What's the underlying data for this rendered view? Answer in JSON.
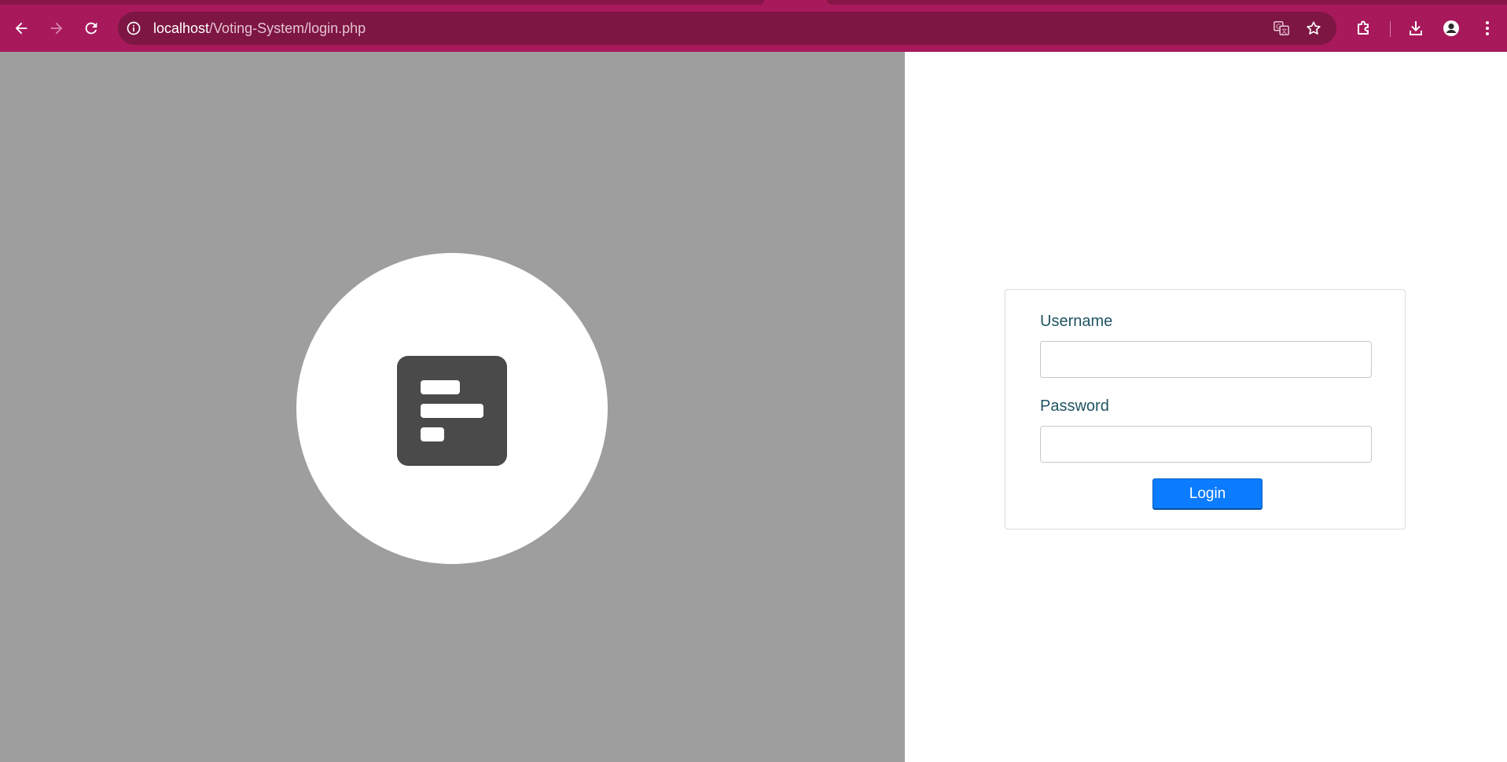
{
  "browser": {
    "url_host": "localhost",
    "url_path": "/Voting-System/login.php",
    "theme_color": "#a8195b",
    "omnibox_color": "#7d1642",
    "icons": {
      "back": "arrow-left-icon",
      "forward": "arrow-right-icon",
      "reload": "reload-icon",
      "site_info": "info-icon",
      "translate": "translate-icon",
      "bookmark": "star-icon",
      "extensions": "puzzle-icon",
      "downloads": "download-icon",
      "profile": "profile-icon",
      "menu": "kebab-menu-icon"
    }
  },
  "left_panel": {
    "background": "#9e9e9e",
    "logo_icon": "form-lines-icon"
  },
  "login": {
    "username_label": "Username",
    "username_value": "",
    "password_label": "Password",
    "password_value": "",
    "submit_label": "Login",
    "label_color": "#1f5562",
    "button_color": "#0b7cff"
  }
}
